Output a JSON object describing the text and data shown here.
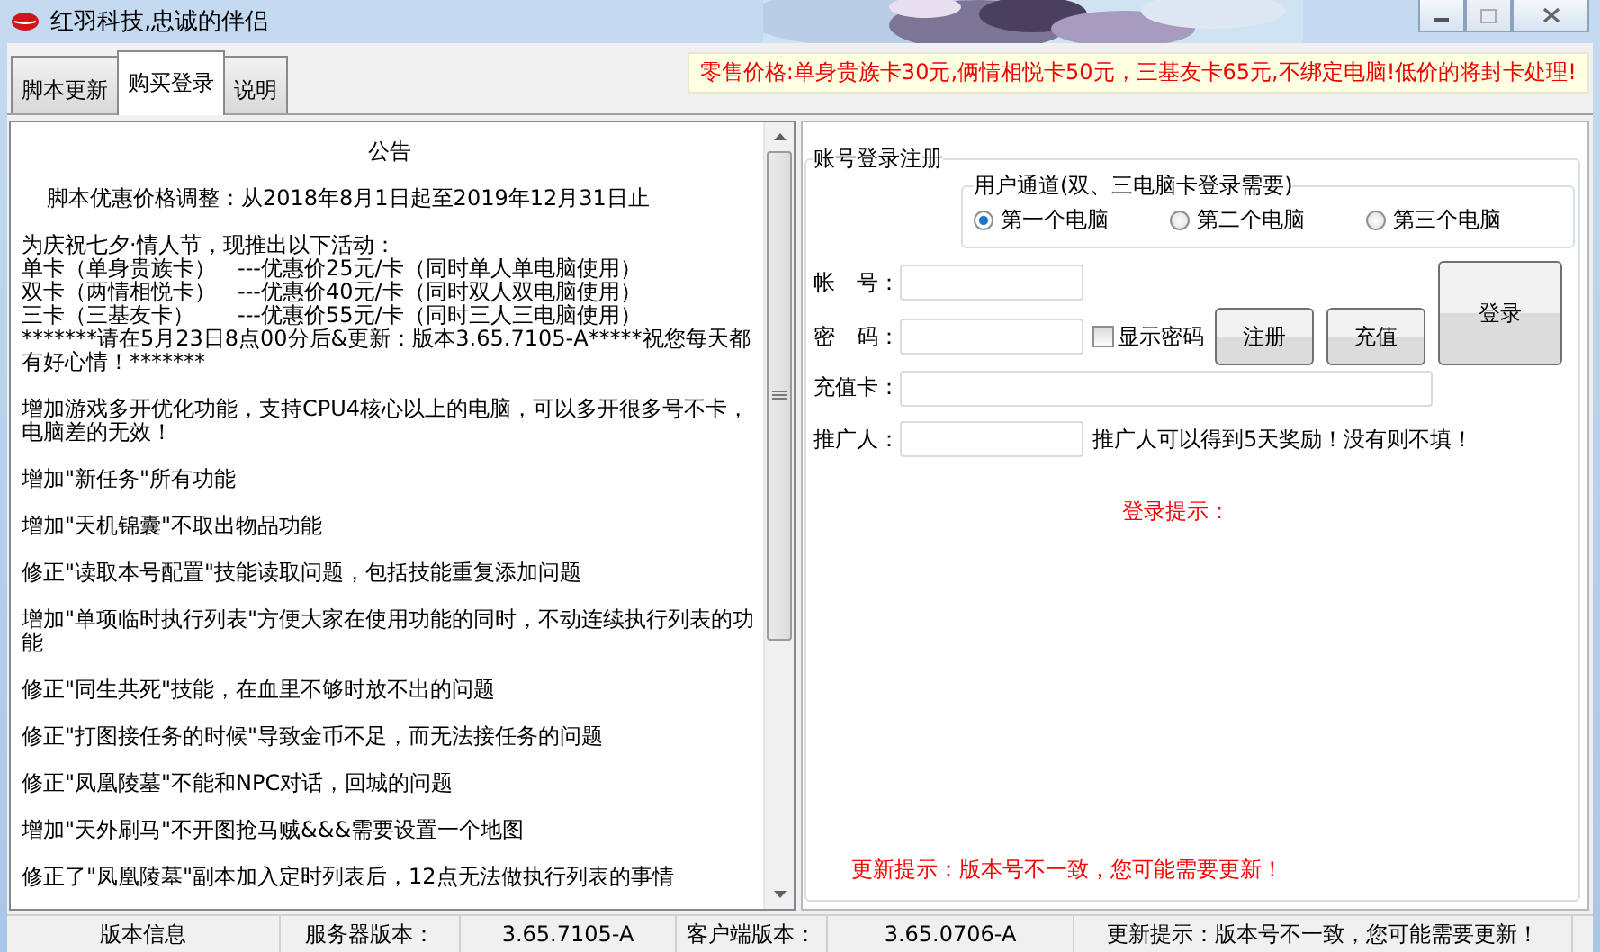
{
  "window": {
    "title": "红羽科技,忠诚的伴侣",
    "maximize_disabled": true
  },
  "tabs": [
    {
      "label": "脚本更新",
      "selected": false
    },
    {
      "label": "购买登录",
      "selected": true
    },
    {
      "label": "说明",
      "selected": false
    }
  ],
  "price_banner": "零售价格:单身贵族卡30元,俩情相悦卡50元，三基友卡65元,不绑定电脑!低价的将封卡处理!",
  "notice": {
    "title": "公告",
    "paragraphs": [
      {
        "indent": true,
        "lines": [
          "脚本优惠价格调整：从2018年8月1日起至2019年12月31日止"
        ]
      },
      {
        "indent": false,
        "lines": [
          "为庆祝七夕·情人节，现推出以下活动：",
          "单卡（单身贵族卡）　---优惠价25元/卡（同时单人单电脑使用）",
          "双卡（两情相悦卡）　---优惠价40元/卡（同时双人双电脑使用）",
          "三卡（三基友卡）　　---优惠价55元/卡（同时三人三电脑使用）",
          "*******请在5月23日8点00分后&更新：版本3.65.7105-A*****祝您每天都有好心情！*******"
        ]
      },
      {
        "indent": false,
        "lines": [
          "增加游戏多开优化功能，支持CPU4核心以上的电脑，可以多开很多号不卡，电脑差的无效！"
        ]
      },
      {
        "indent": false,
        "lines": [
          "增加\"新任务\"所有功能"
        ]
      },
      {
        "indent": false,
        "lines": [
          "增加\"天机锦囊\"不取出物品功能"
        ]
      },
      {
        "indent": false,
        "lines": [
          "修正\"读取本号配置\"技能读取问题，包括技能重复添加问题"
        ]
      },
      {
        "indent": false,
        "lines": [
          "增加\"单项临时执行列表\"方便大家在使用功能的同时，不动连续执行列表的功能"
        ]
      },
      {
        "indent": false,
        "lines": [
          "修正\"同生共死\"技能，在血里不够时放不出的问题"
        ]
      },
      {
        "indent": false,
        "lines": [
          "修正\"打图接任务的时候\"导致金币不足，而无法接任务的问题"
        ]
      },
      {
        "indent": false,
        "lines": [
          "修正\"凤凰陵墓\"不能和NPC对话，回城的问题"
        ]
      },
      {
        "indent": false,
        "lines": [
          "增加\"天外刷马\"不开图抢马贼&&&需要设置一个地图"
        ]
      },
      {
        "indent": false,
        "lines": [
          "修正了\"凤凰陵墓\"副本加入定时列表后，12点无法做执行列表的事情"
        ]
      }
    ]
  },
  "login": {
    "title": "账号登录注册",
    "channel": {
      "title": "用户通道(双、三电脑卡登录需要)",
      "options": [
        {
          "label": "第一个电脑",
          "selected": true
        },
        {
          "label": "第二个电脑",
          "selected": false
        },
        {
          "label": "第三个电脑",
          "selected": false
        }
      ]
    },
    "account_label": "帐　号：",
    "password_label": "密　码：",
    "show_password": {
      "label": "显示密码",
      "checked": false
    },
    "register_button": "注册",
    "recharge_button": "充值",
    "login_button": "登录",
    "card_label": "充值卡：",
    "referrer_label": "推广人：",
    "referrer_hint": "推广人可以得到5天奖励！没有则不填！",
    "login_hint": "登录提示：",
    "update_hint": "更新提示：版本号不一致，您可能需要更新！"
  },
  "status_bar": [
    "版本信息",
    "服务器版本：",
    "3.65.7105-A",
    "客户端版本：",
    "3.65.0706-A",
    "更新提示：版本号不一致，您可能需要更新！"
  ]
}
